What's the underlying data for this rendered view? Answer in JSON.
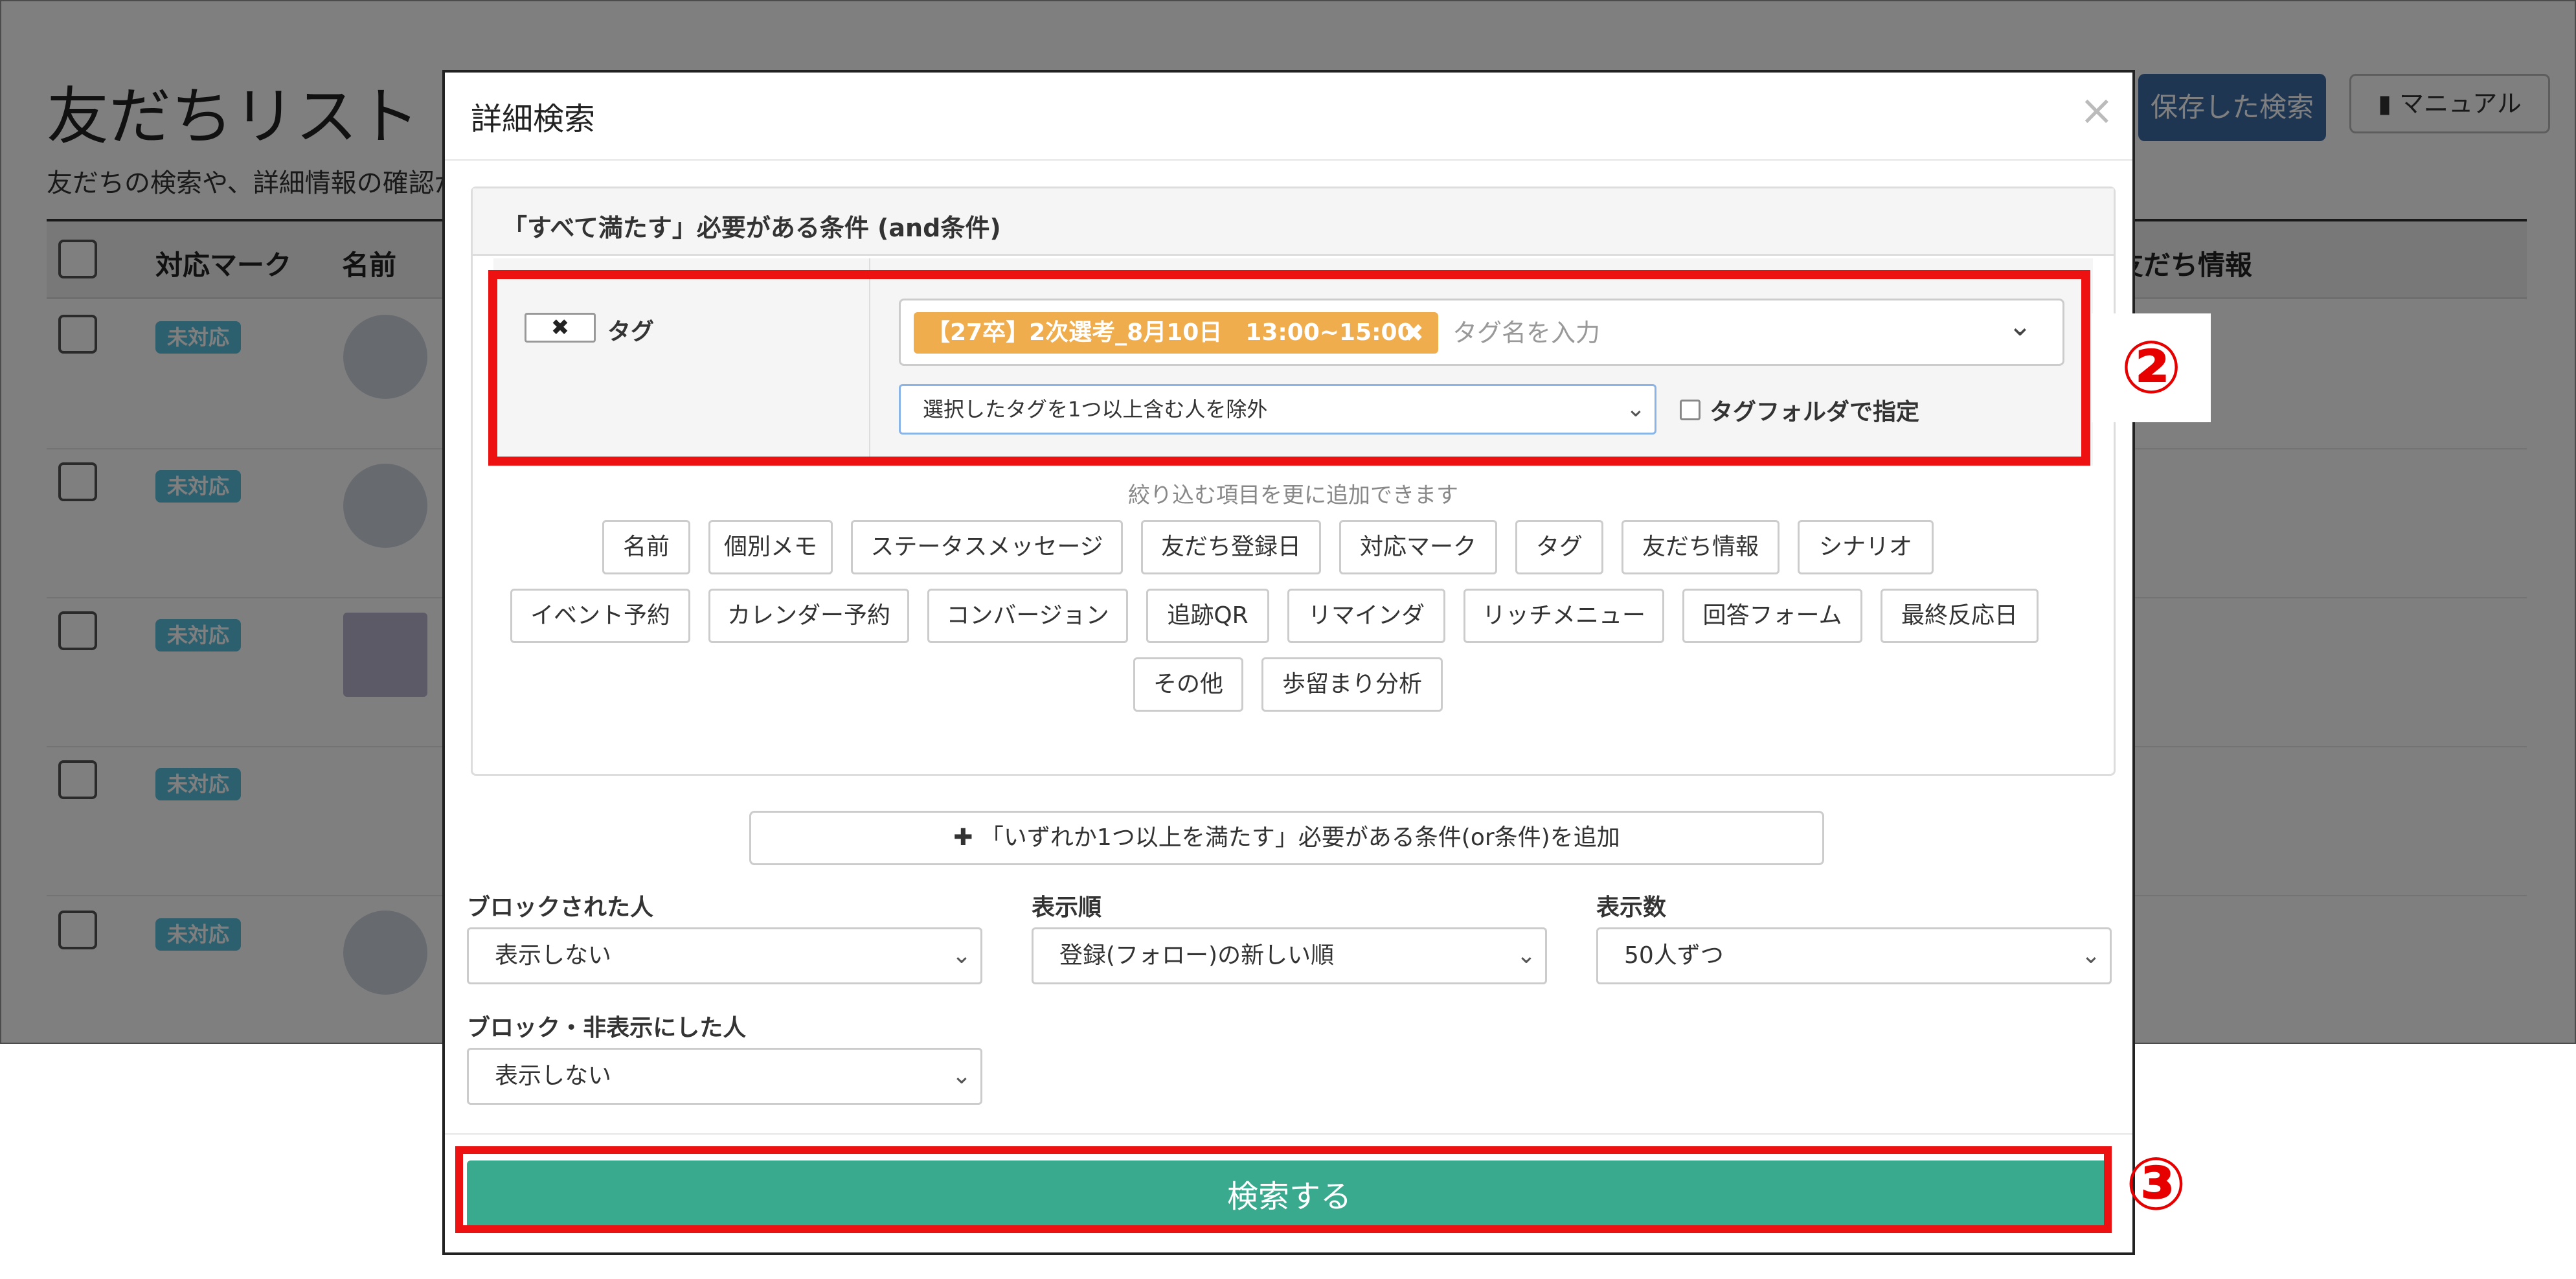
{
  "background_page": {
    "title": "友だちリスト",
    "subtitle": "友だちの検索や、詳細情報の確認が",
    "saved_search_button": "保存した検索",
    "manual_button": "マニュアル",
    "table_headers": [
      "対応マーク",
      "名前",
      "友だち情報"
    ],
    "status_badge": "未対応"
  },
  "modal": {
    "title": "詳細検索",
    "close_glyph": "×",
    "and_section_label": "「すべて満たす」必要がある条件 (and条件)",
    "condition": {
      "remove_glyph": "✖",
      "type_label": "タグ",
      "selected_tag": "【27卒】2次選考_8月10日　13:00~15:00",
      "tag_remove_glyph": "✖",
      "tag_input_placeholder": "タグ名を入力",
      "mode_select": "選択したタグを1つ以上含む人を除外",
      "folder_label": "タグフォルダで指定"
    },
    "add_hint": "絞り込む項目を更に追加できます",
    "field_buttons": [
      [
        "名前",
        "個別メモ",
        "ステータスメッセージ",
        "友だち登録日",
        "対応マーク",
        "タグ",
        "友だち情報",
        "シナリオ"
      ],
      [
        "イベント予約",
        "カレンダー予約",
        "コンバージョン",
        "追跡QR",
        "リマインダ",
        "リッチメニュー",
        "回答フォーム",
        "最終反応日"
      ],
      [
        "その他",
        "歩留まり分析"
      ]
    ],
    "or_add_button": "「いずれか1つ以上を満たす」必要がある条件(or条件)を追加",
    "options": {
      "blocked": {
        "label": "ブロックされた人",
        "value": "表示しない"
      },
      "order": {
        "label": "表示順",
        "value": "登録(フォロー)の新しい順"
      },
      "count": {
        "label": "表示数",
        "value": "50人ずつ"
      },
      "hidden": {
        "label": "ブロック・非表示にした人",
        "value": "表示しない"
      }
    },
    "search_button": "検索する"
  },
  "annotations": {
    "marker_2": "②",
    "marker_3": "③",
    "highlight_color": "#ee1111"
  },
  "colors": {
    "tag_chip": "#f0ad4e",
    "search_button": "#3aaa8f",
    "saved_search_button": "#3f6ca6",
    "badge": "#5bc0de"
  }
}
